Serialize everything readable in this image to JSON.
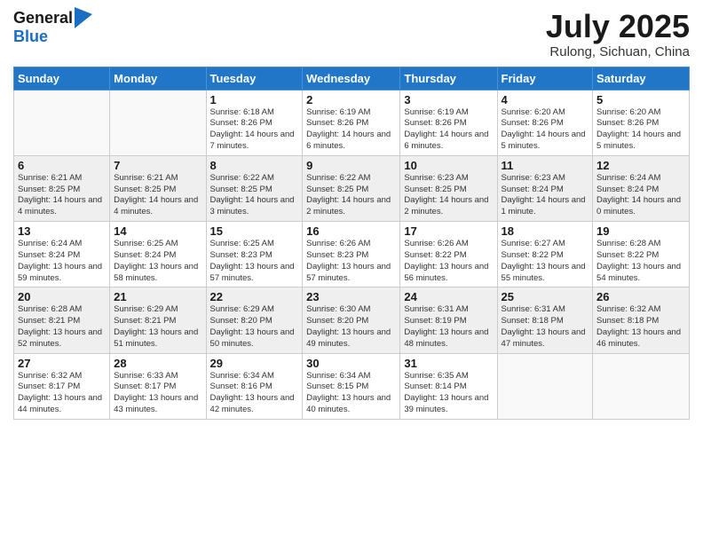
{
  "logo": {
    "general": "General",
    "blue": "Blue"
  },
  "title": "July 2025",
  "subtitle": "Rulong, Sichuan, China",
  "days_of_week": [
    "Sunday",
    "Monday",
    "Tuesday",
    "Wednesday",
    "Thursday",
    "Friday",
    "Saturday"
  ],
  "weeks": [
    [
      {
        "day": "",
        "info": ""
      },
      {
        "day": "",
        "info": ""
      },
      {
        "day": "1",
        "info": "Sunrise: 6:18 AM\nSunset: 8:26 PM\nDaylight: 14 hours and 7 minutes."
      },
      {
        "day": "2",
        "info": "Sunrise: 6:19 AM\nSunset: 8:26 PM\nDaylight: 14 hours and 6 minutes."
      },
      {
        "day": "3",
        "info": "Sunrise: 6:19 AM\nSunset: 8:26 PM\nDaylight: 14 hours and 6 minutes."
      },
      {
        "day": "4",
        "info": "Sunrise: 6:20 AM\nSunset: 8:26 PM\nDaylight: 14 hours and 5 minutes."
      },
      {
        "day": "5",
        "info": "Sunrise: 6:20 AM\nSunset: 8:26 PM\nDaylight: 14 hours and 5 minutes."
      }
    ],
    [
      {
        "day": "6",
        "info": "Sunrise: 6:21 AM\nSunset: 8:25 PM\nDaylight: 14 hours and 4 minutes."
      },
      {
        "day": "7",
        "info": "Sunrise: 6:21 AM\nSunset: 8:25 PM\nDaylight: 14 hours and 4 minutes."
      },
      {
        "day": "8",
        "info": "Sunrise: 6:22 AM\nSunset: 8:25 PM\nDaylight: 14 hours and 3 minutes."
      },
      {
        "day": "9",
        "info": "Sunrise: 6:22 AM\nSunset: 8:25 PM\nDaylight: 14 hours and 2 minutes."
      },
      {
        "day": "10",
        "info": "Sunrise: 6:23 AM\nSunset: 8:25 PM\nDaylight: 14 hours and 2 minutes."
      },
      {
        "day": "11",
        "info": "Sunrise: 6:23 AM\nSunset: 8:24 PM\nDaylight: 14 hours and 1 minute."
      },
      {
        "day": "12",
        "info": "Sunrise: 6:24 AM\nSunset: 8:24 PM\nDaylight: 14 hours and 0 minutes."
      }
    ],
    [
      {
        "day": "13",
        "info": "Sunrise: 6:24 AM\nSunset: 8:24 PM\nDaylight: 13 hours and 59 minutes."
      },
      {
        "day": "14",
        "info": "Sunrise: 6:25 AM\nSunset: 8:24 PM\nDaylight: 13 hours and 58 minutes."
      },
      {
        "day": "15",
        "info": "Sunrise: 6:25 AM\nSunset: 8:23 PM\nDaylight: 13 hours and 57 minutes."
      },
      {
        "day": "16",
        "info": "Sunrise: 6:26 AM\nSunset: 8:23 PM\nDaylight: 13 hours and 57 minutes."
      },
      {
        "day": "17",
        "info": "Sunrise: 6:26 AM\nSunset: 8:22 PM\nDaylight: 13 hours and 56 minutes."
      },
      {
        "day": "18",
        "info": "Sunrise: 6:27 AM\nSunset: 8:22 PM\nDaylight: 13 hours and 55 minutes."
      },
      {
        "day": "19",
        "info": "Sunrise: 6:28 AM\nSunset: 8:22 PM\nDaylight: 13 hours and 54 minutes."
      }
    ],
    [
      {
        "day": "20",
        "info": "Sunrise: 6:28 AM\nSunset: 8:21 PM\nDaylight: 13 hours and 52 minutes."
      },
      {
        "day": "21",
        "info": "Sunrise: 6:29 AM\nSunset: 8:21 PM\nDaylight: 13 hours and 51 minutes."
      },
      {
        "day": "22",
        "info": "Sunrise: 6:29 AM\nSunset: 8:20 PM\nDaylight: 13 hours and 50 minutes."
      },
      {
        "day": "23",
        "info": "Sunrise: 6:30 AM\nSunset: 8:20 PM\nDaylight: 13 hours and 49 minutes."
      },
      {
        "day": "24",
        "info": "Sunrise: 6:31 AM\nSunset: 8:19 PM\nDaylight: 13 hours and 48 minutes."
      },
      {
        "day": "25",
        "info": "Sunrise: 6:31 AM\nSunset: 8:18 PM\nDaylight: 13 hours and 47 minutes."
      },
      {
        "day": "26",
        "info": "Sunrise: 6:32 AM\nSunset: 8:18 PM\nDaylight: 13 hours and 46 minutes."
      }
    ],
    [
      {
        "day": "27",
        "info": "Sunrise: 6:32 AM\nSunset: 8:17 PM\nDaylight: 13 hours and 44 minutes."
      },
      {
        "day": "28",
        "info": "Sunrise: 6:33 AM\nSunset: 8:17 PM\nDaylight: 13 hours and 43 minutes."
      },
      {
        "day": "29",
        "info": "Sunrise: 6:34 AM\nSunset: 8:16 PM\nDaylight: 13 hours and 42 minutes."
      },
      {
        "day": "30",
        "info": "Sunrise: 6:34 AM\nSunset: 8:15 PM\nDaylight: 13 hours and 40 minutes."
      },
      {
        "day": "31",
        "info": "Sunrise: 6:35 AM\nSunset: 8:14 PM\nDaylight: 13 hours and 39 minutes."
      },
      {
        "day": "",
        "info": ""
      },
      {
        "day": "",
        "info": ""
      }
    ]
  ]
}
